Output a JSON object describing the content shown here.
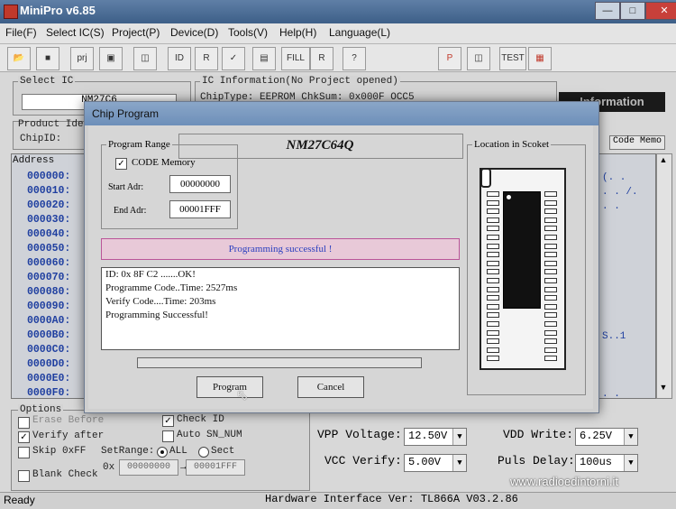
{
  "window": {
    "title": "MiniPro v6.85"
  },
  "menu": [
    "File(F)",
    "Select IC(S)",
    "Project(P)",
    "Device(D)",
    "Tools(V)",
    "Help(H)",
    "Language(L)"
  ],
  "toolbar_labels": {
    "prj": "prj",
    "fill": "FILL",
    "test": "TEST"
  },
  "select_ic": {
    "legend": "Select IC",
    "value": "NM27C6"
  },
  "ic_info": {
    "legend": "IC Information(No Project opened)",
    "line1": "ChipType:  EEPROM    ChkSum: 0x000F OCC5"
  },
  "product_ident": {
    "legend": "Product Iden",
    "chip_id_label": "ChipID:"
  },
  "information_button": "Information",
  "code_memo_tab": "Code Memo",
  "address_header": "Address",
  "addresses": [
    "000000:",
    "000010:",
    "000020:",
    "000030:",
    "000040:",
    "000050:",
    "000060:",
    "000070:",
    "000080:",
    "000090:",
    "0000A0:",
    "0000B0:",
    "0000C0:",
    "0000D0:",
    "0000E0:",
    "0000F0:"
  ],
  "ascii_col": [
    "(. .",
    ". . /.",
    ". .",
    "",
    "",
    "",
    "",
    "",
    "",
    "",
    "",
    "S..1",
    "",
    "",
    "",
    ". ."
  ],
  "options": {
    "legend": "Options",
    "erase_before": "Erase Before",
    "verify_after": "Verify after",
    "skip_0xff": "Skip 0xFF",
    "blank_check": "Blank Check",
    "check_id": "Check ID",
    "auto_sn_num": "Auto SN_NUM",
    "set_range": "SetRange:",
    "all": "ALL",
    "sect": "Sect",
    "range_prefix": "0x",
    "range_from": "00000000",
    "range_to": "00001FFF"
  },
  "voltages": {
    "vpp_label": "VPP Voltage:",
    "vpp_value": "12.50V",
    "vcc_label": "VCC Verify:",
    "vcc_value": "5.00V",
    "vdd_label": "VDD Write:",
    "vdd_value": "6.25V",
    "puls_label": "Puls Delay:",
    "puls_value": "100us"
  },
  "status_bar": {
    "ready": "Ready",
    "hw": "Hardware Interface Ver: TL866A V03.2.86"
  },
  "watermark": "www.radioedintorni.it",
  "dialog": {
    "title": "Chip Program",
    "chip_name": "NM27C64Q",
    "range_legend": "Program Range",
    "code_memory": "CODE Memory",
    "start_label": "Start Adr:",
    "start_value": "00000000",
    "end_label": "End Adr:",
    "end_value": "00001FFF",
    "socket_legend": "Location in Scoket",
    "status": "Programming successful !",
    "log": [
      "ID: 0x 8F C2 .......OK!",
      "Programme Code..Time: 2527ms",
      "Verify Code....Time: 203ms",
      "Programming Successful!"
    ],
    "program_button": "Program",
    "cancel_button": "Cancel"
  }
}
